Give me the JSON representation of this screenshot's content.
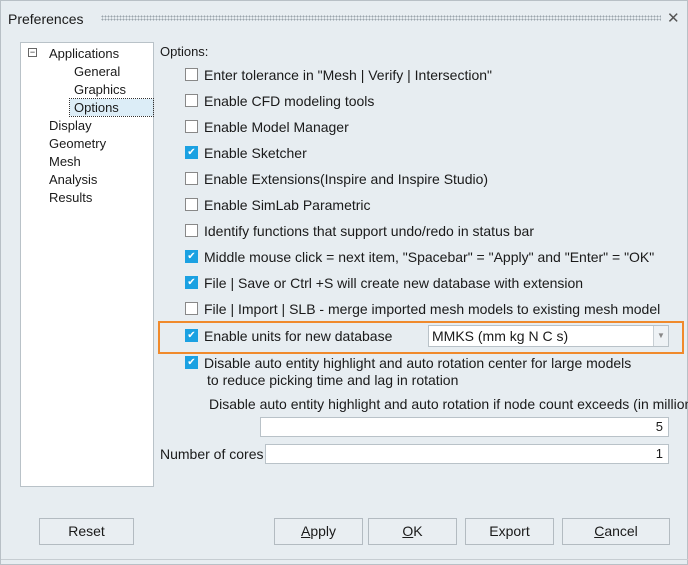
{
  "window": {
    "title": "Preferences",
    "close_icon": "close-icon"
  },
  "tree": {
    "items": [
      {
        "label": "Applications",
        "expanded": true
      },
      {
        "label": "General"
      },
      {
        "label": "Graphics"
      },
      {
        "label": "Options",
        "selected": true
      },
      {
        "label": "Display"
      },
      {
        "label": "Geometry"
      },
      {
        "label": "Mesh"
      },
      {
        "label": "Analysis"
      },
      {
        "label": "Results"
      }
    ],
    "expander": "−"
  },
  "options": {
    "heading": "Options:",
    "checks": [
      {
        "label": "Enter tolerance in \"Mesh | Verify | Intersection\"",
        "checked": false
      },
      {
        "label": "Enable CFD modeling tools",
        "checked": false
      },
      {
        "label": "Enable Model Manager",
        "checked": false
      },
      {
        "label": "Enable Sketcher",
        "checked": true
      },
      {
        "label": "Enable Extensions(Inspire and Inspire Studio)",
        "checked": false
      },
      {
        "label": "Enable SimLab Parametric",
        "checked": false
      },
      {
        "label": "Identify functions that support undo/redo in status bar",
        "checked": false
      },
      {
        "label": "Middle mouse click = next item, \"Spacebar\" = \"Apply\" and \"Enter\" = \"OK\"",
        "checked": true
      },
      {
        "label": "File | Save or Ctrl +S will create new database with extension",
        "checked": true
      },
      {
        "label": "File | Import | SLB - merge imported mesh models to existing mesh model",
        "checked": false
      }
    ],
    "units": {
      "label": "Enable units for new database",
      "checked": true,
      "value": "MMKS (mm kg N C s)"
    },
    "disable_highlight": {
      "line1": "Disable auto entity highlight and auto rotation center for large models",
      "line2": "to reduce picking time and lag in rotation",
      "checked": true
    },
    "node_count_label": "Disable auto entity highlight and auto rotation if node count exceeds (in million)",
    "node_count_value": "5",
    "cores_label": "Number of cores",
    "cores_value": "1"
  },
  "buttons": {
    "reset": "Reset",
    "apply_u": "A",
    "apply_rest": "pply",
    "ok_u": "O",
    "ok_rest": "K",
    "export": "Export",
    "cancel_u": "C",
    "cancel_rest": "ancel"
  },
  "colors": {
    "accent": "#1ba1e2",
    "highlight_border": "#f08a2c"
  }
}
